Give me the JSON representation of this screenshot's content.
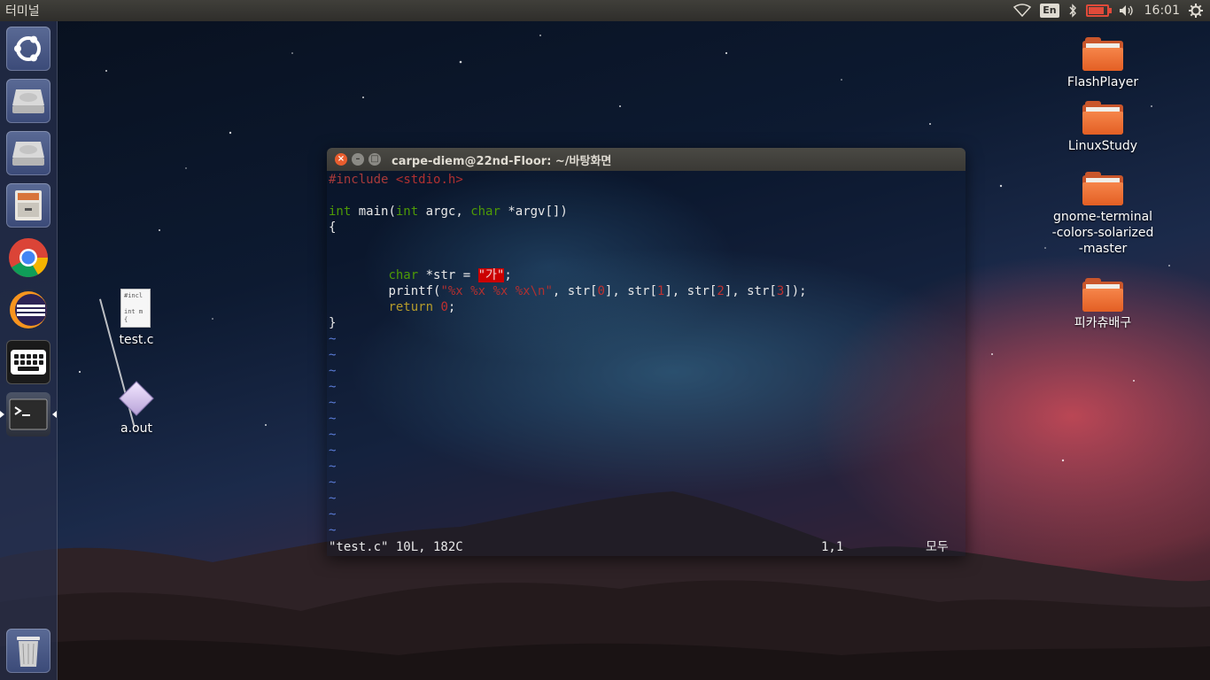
{
  "top_panel": {
    "app_title": "터미널",
    "keyboard_layout": "En",
    "clock": "16:01",
    "battery_level": 0.85,
    "icons": [
      "wifi-icon",
      "bluetooth-icon",
      "battery-icon",
      "volume-icon",
      "gear-icon"
    ]
  },
  "launcher": {
    "items": [
      "ubuntu-dash-icon",
      "drive-icon",
      "drive-icon",
      "file-cabinet-icon",
      "chrome-icon",
      "eclipse-icon",
      "keyboard-icon",
      "terminal-icon",
      "trash-icon"
    ]
  },
  "desktop": {
    "left_icons": [
      {
        "label": "test.c",
        "preview": "#incl\n\nint m\n{"
      },
      {
        "label": "a.out"
      }
    ],
    "right_icons": [
      {
        "label": "FlashPlayer"
      },
      {
        "label": "LinuxStudy"
      },
      {
        "label": "gnome-terminal-colors-solarized-master"
      },
      {
        "label": "피카츄배구"
      }
    ]
  },
  "terminal": {
    "title": "carpe-diem@22nd-Floor: ~/바탕화면",
    "code": {
      "l1_hash": "#",
      "l1_include": "include",
      "l1_header": "<stdio.h>",
      "l3_int1": "int",
      "l3_main": " main(",
      "l3_int2": "int",
      "l3_argc": " argc, ",
      "l3_char": "char",
      "l3_argv": " *argv[])",
      "l4": "{",
      "l7_char": "char",
      "l7_rest": " *str = ",
      "l7_str": "\"가\"",
      "l7_end": ";",
      "l8_printf": "printf(",
      "l8_fmt": "\"%x %x %x %x\\n\"",
      "l8_a": ", str[",
      "l8_0": "0",
      "l8_b": "], str[",
      "l8_1": "1",
      "l8_c": "], str[",
      "l8_2": "2",
      "l8_d": "], str[",
      "l8_3": "3",
      "l8_e": "]);",
      "l9_return": "return",
      "l9_0": " 0",
      "l9_end": ";",
      "l10": "}"
    },
    "tilde": "~",
    "status_file": "\"test.c\" 10L, 182C",
    "status_pos": "1,1",
    "status_all": "모두"
  }
}
